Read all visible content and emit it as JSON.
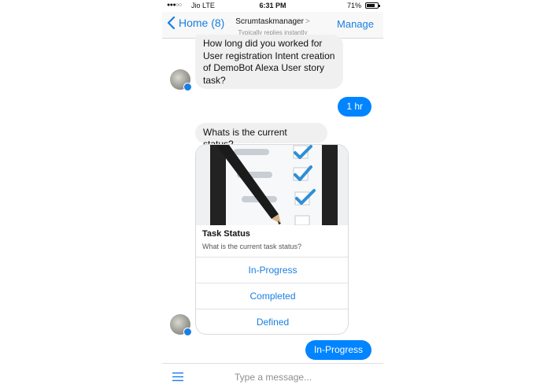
{
  "status_bar": {
    "signal": "●●●○○",
    "carrier": "Jio  LTE",
    "time": "6:31 PM",
    "battery": "71%"
  },
  "nav": {
    "back_label": "Home (8)",
    "title": "Scrumtaskmanager",
    "title_chevron": ">",
    "subtitle": "Typically replies instantly",
    "manage_label": "Manage"
  },
  "messages": [
    {
      "from": "bot",
      "text": "How long did you worked for User registration Intent creation of DemoBot Alexa User story task?"
    },
    {
      "from": "user",
      "text": "1 hr"
    },
    {
      "from": "bot",
      "text": "Whats is the current status?"
    },
    {
      "from": "user",
      "text": "In-Progress"
    }
  ],
  "card": {
    "title": "Task Status",
    "subtitle": "What is the current task status?",
    "options": [
      "In-Progress",
      "Completed",
      "Defined"
    ]
  },
  "composer": {
    "placeholder": "Type a message..."
  },
  "colors": {
    "accent": "#0084ff",
    "link": "#1a7fe3",
    "incoming_bubble": "#f1f0f0"
  },
  "icons": [
    "back-chevron-icon",
    "menu-icon",
    "messenger-badge-icon",
    "battery-icon",
    "signal-icon"
  ]
}
